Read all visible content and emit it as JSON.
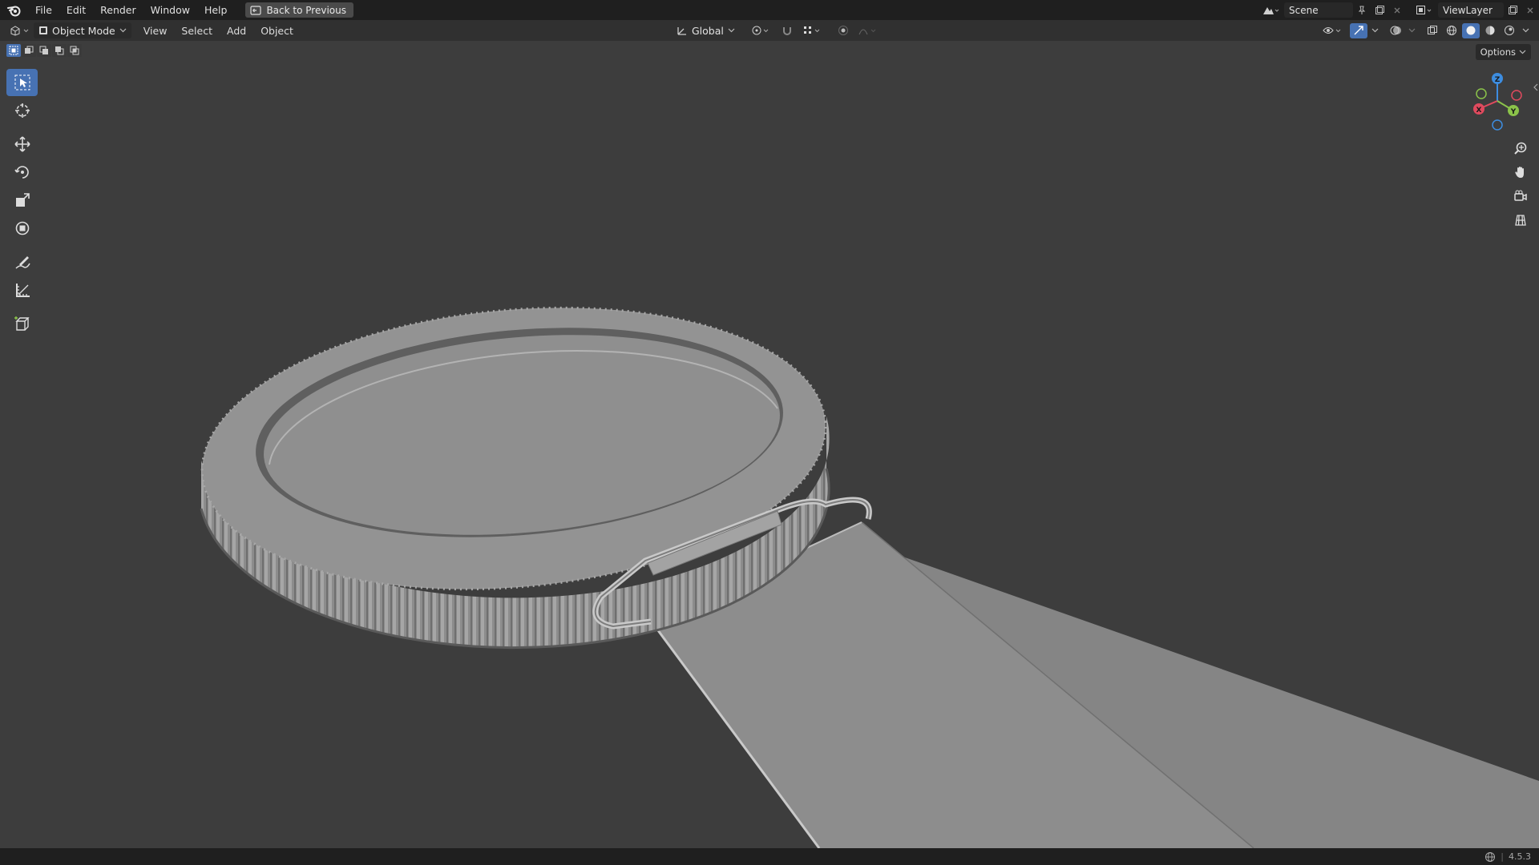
{
  "topbar": {
    "menus": [
      "File",
      "Edit",
      "Render",
      "Window",
      "Help"
    ],
    "back_button": "Back to Previous",
    "scene": "Scene",
    "view_layer": "ViewLayer"
  },
  "header": {
    "mode": "Object Mode",
    "menus": [
      "View",
      "Select",
      "Add",
      "Object"
    ],
    "orientation": "Global",
    "options": "Options"
  },
  "toolbar": {
    "tools": [
      "select-box",
      "cursor",
      "move",
      "rotate",
      "scale",
      "transform",
      "annotate",
      "measure",
      "add-cube"
    ],
    "active": "select-box"
  },
  "gizmo": {
    "x": "X",
    "y": "Y",
    "z": "Z"
  },
  "status": {
    "version": "4.5.3"
  },
  "colors": {
    "accent": "#4772b3",
    "viewport_bg": "#3d3d3d",
    "axis_x": "#e04a5e",
    "axis_y": "#8bc34a",
    "axis_z": "#3d8de0"
  }
}
